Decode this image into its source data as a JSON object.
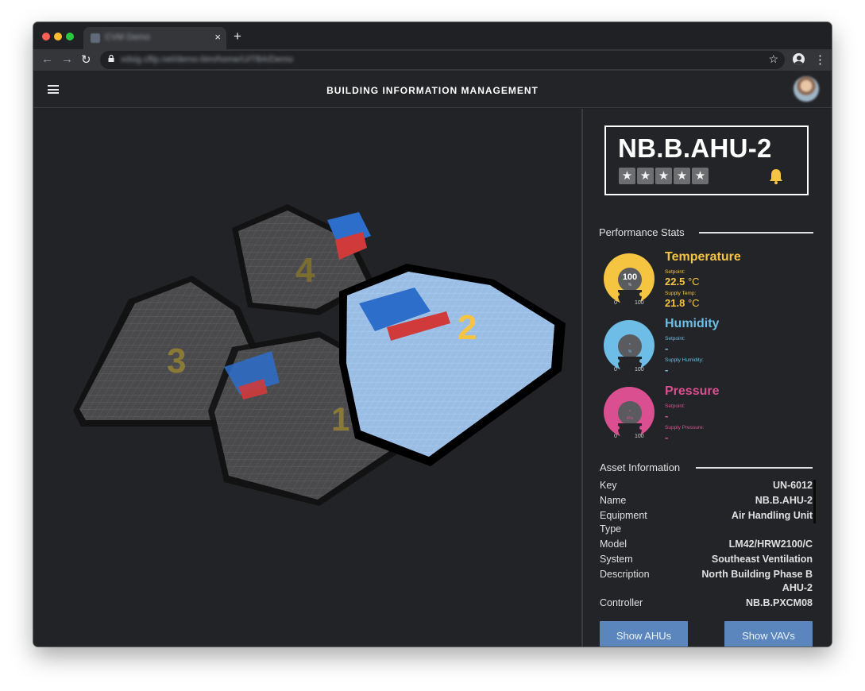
{
  "browser": {
    "tab_title": "CVM Demo",
    "tab_close": "×",
    "new_tab": "+",
    "url": "xdsig.cflip.net/demo-bim/home/UITBA/Demo",
    "back": "←",
    "forward": "→",
    "reload": "↻",
    "bookmark": "☆",
    "menu": "⋮"
  },
  "app": {
    "title": "BUILDING INFORMATION MANAGEMENT",
    "menu_icon": "hamburger-icon"
  },
  "map": {
    "buildings": [
      "1",
      "2",
      "3",
      "4"
    ],
    "selected_building": "2"
  },
  "asset": {
    "name": "NB.B.AHU-2",
    "star": "★",
    "rating_slots": 5,
    "alert_icon": "bell-icon"
  },
  "performance": {
    "section_title": "Performance Stats",
    "temperature": {
      "title": "Temperature",
      "color": "#f5c542",
      "gauge_value": "100",
      "gauge_unit": "%",
      "gauge_min": "0",
      "gauge_max": "100",
      "setpoint_label": "Setpoint:",
      "setpoint_value": "22.5",
      "setpoint_unit": "°C",
      "supply_label": "Supply Temp:",
      "supply_value": "21.8",
      "supply_unit": "°C"
    },
    "humidity": {
      "title": "Humidity",
      "color": "#6dbde6",
      "gauge_value": "-",
      "gauge_unit": "%",
      "gauge_min": "0",
      "gauge_max": "100",
      "setpoint_label": "Setpoint:",
      "setpoint_value": "-",
      "supply_label": "Supply Humidity:",
      "supply_value": "-"
    },
    "pressure": {
      "title": "Pressure",
      "color": "#d94f8f",
      "gauge_value": "-",
      "gauge_unit": "kPa",
      "gauge_min": "0",
      "gauge_max": "100",
      "setpoint_label": "Setpoint:",
      "setpoint_value": "-",
      "supply_label": "Supply Pressure:",
      "supply_value": "-"
    }
  },
  "asset_info": {
    "section_title": "Asset Information",
    "rows": [
      {
        "key": "Key",
        "value": "UN-6012"
      },
      {
        "key": "Name",
        "value": "NB.B.AHU-2"
      },
      {
        "key": "Equipment Type",
        "value": "Air Handling Unit"
      },
      {
        "key": "Model",
        "value": "LM42/HRW2100/C"
      },
      {
        "key": "System",
        "value": "Southeast Ventilation"
      },
      {
        "key": "Description",
        "value": "North Building Phase B AHU-2"
      },
      {
        "key": "Controller",
        "value": "NB.B.PXCM08"
      }
    ]
  },
  "actions": {
    "show_ahus": "Show AHUs",
    "show_vavs": "Show VAVs"
  }
}
